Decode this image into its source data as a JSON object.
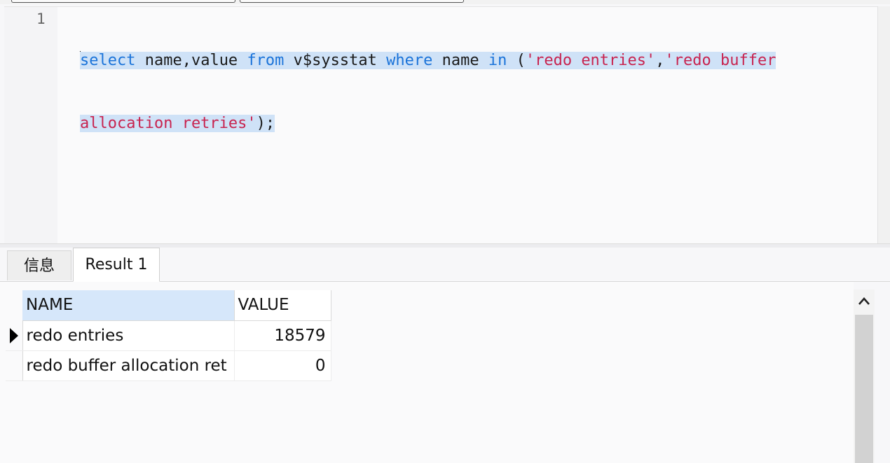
{
  "editor": {
    "line_number": "1",
    "code": {
      "kw_select": "select",
      "t_cols": " name,value ",
      "kw_from": "from",
      "t_table": " v$sysstat ",
      "kw_where": "where",
      "t_name": " name ",
      "kw_in": "in",
      "t_paren": " (",
      "str1": "'redo entries'",
      "t_comma": ",",
      "str2a": "'redo buffer",
      "str2b": "allocation retries'",
      "t_end": ");"
    }
  },
  "tabs": {
    "info_label": "信息",
    "result_label": "Result 1"
  },
  "grid": {
    "columns": [
      "NAME",
      "VALUE"
    ],
    "rows": [
      {
        "name": "redo entries",
        "value": "18579"
      },
      {
        "name": "redo buffer allocation ret",
        "value": "0"
      }
    ]
  },
  "colors": {
    "keyword": "#1a73d9",
    "string": "#c8234f",
    "selection": "#cfe2f7",
    "header_selected": "#d6e7fa"
  },
  "icons": {
    "row_indicator": "current-row-arrow-icon",
    "scroll_up": "chevron-up-icon"
  }
}
